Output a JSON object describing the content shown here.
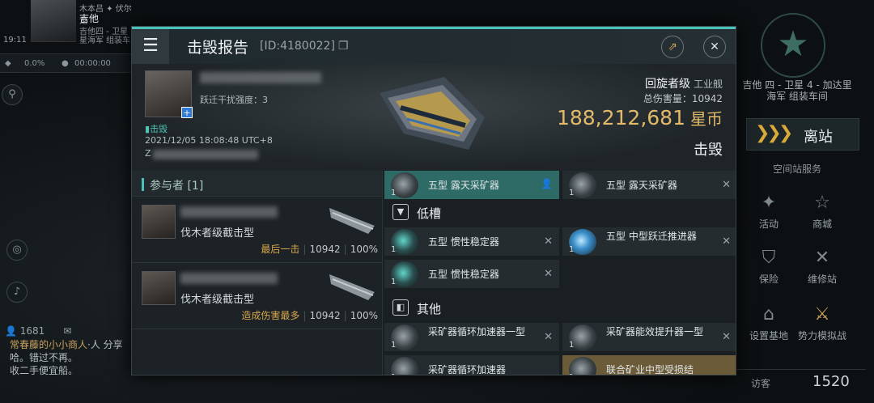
{
  "hud": {
    "pilot_small": "木本吕 ",
    "pilot_star": "伏尔龙",
    "pilot_name": "吉他",
    "pilot_loc1": "吉他四 - 卫星",
    "pilot_loc2": "星海军 组装车",
    "clock": "19:11",
    "stat1": "0.0%",
    "stat2": "00:00:00",
    "online_count": "1681",
    "chat_line1": "人 分享",
    "chat_name": "常春藤的小小商人",
    "chat_line2": "哈。错过不再。",
    "chat_line3": "收二手便宜船。",
    "right_location1": "吉他 四 - 卫星 4 - 加达里",
    "right_location2": "海军 组装车间",
    "undock_label": "离站",
    "service_label": "空间站服务",
    "btn_activity": "活动",
    "btn_market": "商城",
    "btn_insurance": "保险",
    "btn_repair": "维修站",
    "btn_base": "设置基地",
    "btn_sim": "势力模拟战",
    "visitor_label": "访客",
    "visitor_count": "1520",
    "emblem_icon": "star-emblem-icon"
  },
  "report": {
    "title": "击毁报告",
    "id_text": "[ID:4180022]",
    "victim": {
      "jump_text": "跃迁干扰强度：3",
      "kill_tag": "击毁",
      "time": "2021/12/05 18:08:48 UTC+8",
      "extra": "Z",
      "ship_name": "回旋者级",
      "ship_class": "工业舰",
      "damage_label": "总伤害量：10942",
      "isk_value": "188,212,681",
      "currency": "星币",
      "status": "击毁"
    },
    "participants_title": "参与者 [1]",
    "attackers": [
      {
        "ship": "伐木者级截击型",
        "role": "最后一击",
        "damage": "10942",
        "percent": "100%"
      },
      {
        "ship": "伐木者级截击型",
        "role": "造成伤害最多",
        "damage": "10942",
        "percent": "100%"
      }
    ],
    "modules_top": [
      {
        "name": "五型 露天采矿器",
        "qty": "1",
        "state": "dropped"
      },
      {
        "name": "五型 露天采矿器",
        "qty": "1",
        "state": "destroyed"
      }
    ],
    "low_slot_label": "低槽",
    "low_slots": [
      {
        "name": "五型 惯性稳定器",
        "qty": "1"
      },
      {
        "name": "五型 中型跃迁推进器",
        "qty": "1"
      },
      {
        "name": "五型 惯性稳定器",
        "qty": "1"
      }
    ],
    "other_label": "其他",
    "other_slots": [
      {
        "name": "采矿器循环加速器一型",
        "qty": "1"
      },
      {
        "name": "采矿器能效提升器一型",
        "qty": "1"
      },
      {
        "name": "采矿器循环加速器",
        "qty": "1"
      },
      {
        "name": "联合矿业中型受损结",
        "qty": "1"
      }
    ]
  },
  "colors": {
    "accent": "#48c3b8",
    "isk": "#e2ba6a",
    "role": "#d6a74d",
    "dropped": "#2e6b67"
  }
}
